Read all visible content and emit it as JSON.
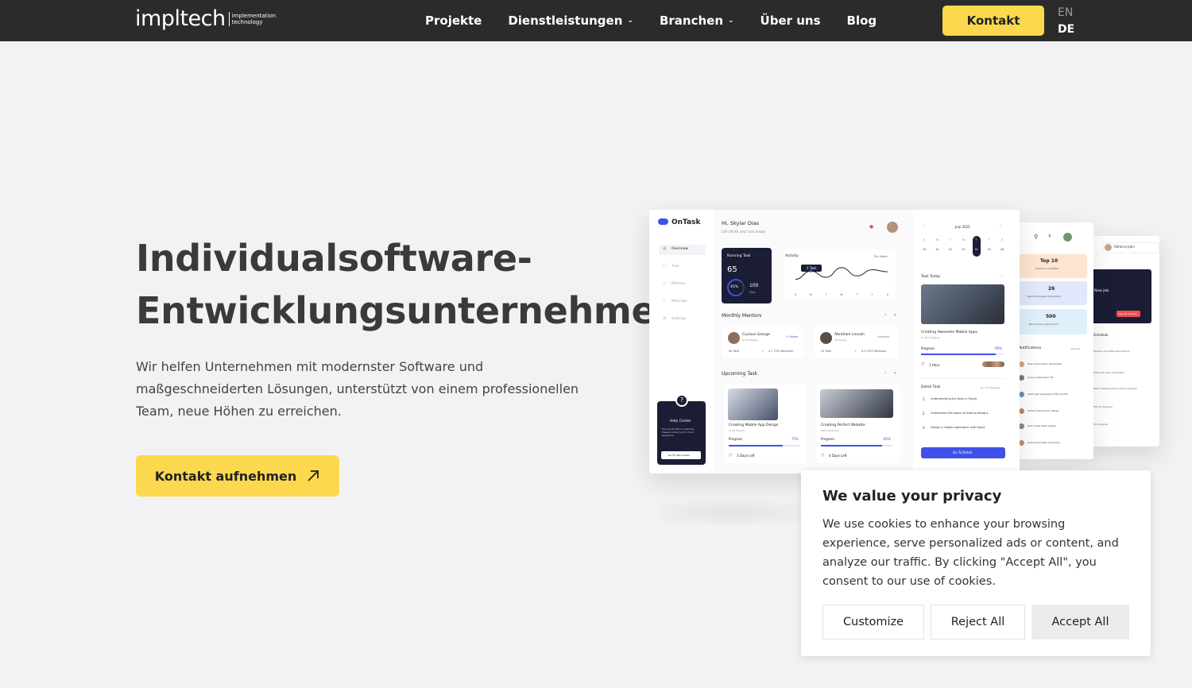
{
  "header": {
    "logo_word": "impltech",
    "logo_tag_line1": "implementation",
    "logo_tag_line2": "technology",
    "nav": [
      {
        "label": "Projekte",
        "dropdown": false
      },
      {
        "label": "Dienstleistungen",
        "dropdown": true
      },
      {
        "label": "Branchen",
        "dropdown": true
      },
      {
        "label": "Über uns",
        "dropdown": false
      },
      {
        "label": "Blog",
        "dropdown": false
      }
    ],
    "contact_label": "Kontakt",
    "lang_en": "EN",
    "lang_de": "DE"
  },
  "hero": {
    "title_line1": "Individualsoftware-",
    "title_line2": "Entwicklungsunternehmen",
    "description": "Wir helfen Unternehmen mit modernster Software und maßgeschneiderten Lösungen, unterstützt von einem professionellen Team, neue Höhen zu erreichen.",
    "cta_label": "Kontakt aufnehmen"
  },
  "mockup": {
    "app_name": "OnTask",
    "greeting": "Hi, Skylar Dias",
    "greeting_sub": "Let's finish your task today!",
    "sidebar": [
      "Overview",
      "Task",
      "Mentors",
      "Message",
      "Settings"
    ],
    "running_task_label": "Running Task",
    "running_task_value": "65",
    "running_task_percent": "45%",
    "running_task_total": "100",
    "running_task_total_label": "Task",
    "activity_label": "Activity",
    "activity_period": "This Week",
    "activity_tooltip": "2 Task",
    "activity_days": [
      "S",
      "M",
      "T",
      "W",
      "T",
      "F",
      "S"
    ],
    "activity_values": [
      1.2,
      2.4,
      1.5,
      2.9,
      1.7,
      2.6,
      2.3
    ],
    "monthly_mentors_label": "Monthly Mentors",
    "mentors": [
      {
        "name": "Curious George",
        "role": "UI UX Design",
        "action": "+ Follow",
        "tasks": "40 Task",
        "rating": "4.7 (750 Reviews)"
      },
      {
        "name": "Abraham Lincoln",
        "role": "3D Design",
        "action": "Followed",
        "tasks": "32 Task",
        "rating": "4.9 (510 Reviews)"
      }
    ],
    "upcoming_label": "Upcoming Task",
    "upcoming": [
      {
        "title": "Creating Mobile App Design",
        "role": "UI UX Design",
        "progress_label": "Progress",
        "progress": "75%",
        "days": "3 Days Left"
      },
      {
        "title": "Creating Perfect Website",
        "role": "Web Developer",
        "progress_label": "Progress",
        "progress": "85%",
        "days": "4 Days Left"
      }
    ],
    "help_title": "Help Center",
    "help_text": "Having Trouble in Learning. Please contact us for more questions.",
    "help_button": "Go To Help Center",
    "calendar_month": "July 2022",
    "calendar_days": [
      "S",
      "M",
      "T",
      "W",
      "T",
      "F",
      "S"
    ],
    "calendar_dates": [
      "10",
      "11",
      "12",
      "13",
      "14",
      "15",
      "16"
    ],
    "task_today_label": "Task Today",
    "task_today_title": "Creating Awesome Mobile Apps",
    "task_today_role": "UI /UX Designer",
    "task_today_progress_label": "Progress",
    "task_today_progress": "90%",
    "task_today_time": "1 Hour",
    "detail_task_label": "Detail Task",
    "detail_task_role": "UI / UX Designer",
    "detail_tasks": [
      "Understanding the tools in Figma",
      "Understand the basics of making designs",
      "Design a mobile application with figma"
    ],
    "detail_button": "Go To Detail",
    "mid_stats": [
      {
        "value": "Top 10",
        "label": "Position in Dribbble"
      },
      {
        "value": "26",
        "label": "New Employees Onboarded"
      },
      {
        "value": "500",
        "label": "New Clients Approached"
      }
    ],
    "notifications_label": "Notifications",
    "notifications_view": "View All",
    "notification_items": [
      "Elise joined team developers",
      "Jenny joined team HR",
      "Adam got employee of the month",
      "Robert joined team design",
      "Jack joined team design",
      "Jane joined team developer"
    ],
    "right_user": "Admirra John",
    "right_card_title": "New Job",
    "right_card_button": "See All Activity",
    "right_schedule": "Schedule",
    "right_items": [
      "Review candidate applications",
      "Interview with candidates",
      "Team meeting with product designer",
      "Hire UI designer",
      "UX Designer"
    ]
  },
  "cookie": {
    "title": "We value your privacy",
    "text": "We use cookies to enhance your browsing experience, serve personalized ads or content, and analyze our traffic. By clicking \"Accept All\", you consent to our use of cookies.",
    "customize": "Customize",
    "reject": "Reject All",
    "accept": "Accept All"
  },
  "colors": {
    "header_bg": "#2b2b2b",
    "accent_yellow": "#fcd84f",
    "page_bg": "#f2f2f4",
    "mock_primary": "#3f51e8",
    "mock_dark": "#1b1d35",
    "mock_red": "#f0504f"
  }
}
